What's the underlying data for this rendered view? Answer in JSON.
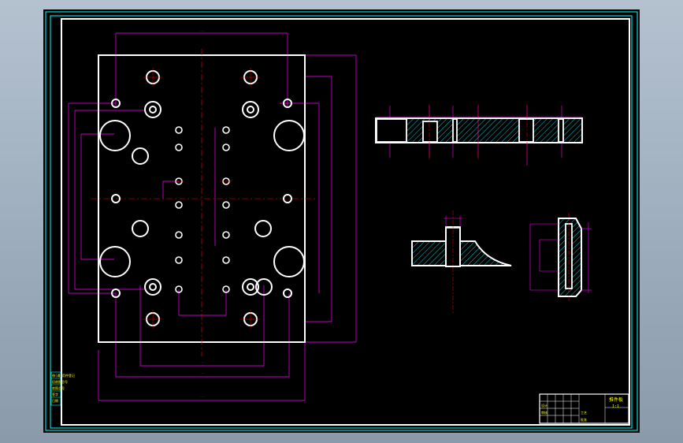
{
  "drawing": {
    "background_color": "#000000",
    "colors": {
      "outline": "#ffffff",
      "dimension": "#ff00ff",
      "centerline": "#ff0000",
      "border": "#00ffff",
      "hatch": "#00ffff",
      "text": "#ffff00"
    },
    "title_block": {
      "title": "推件板",
      "scale": "1:1",
      "labels": [
        "设计",
        "审核",
        "工艺",
        "批准"
      ]
    },
    "side_stamp": [
      "借(通)用件登记",
      "旧底图总号",
      "底图总号",
      "签字",
      "日期"
    ]
  }
}
